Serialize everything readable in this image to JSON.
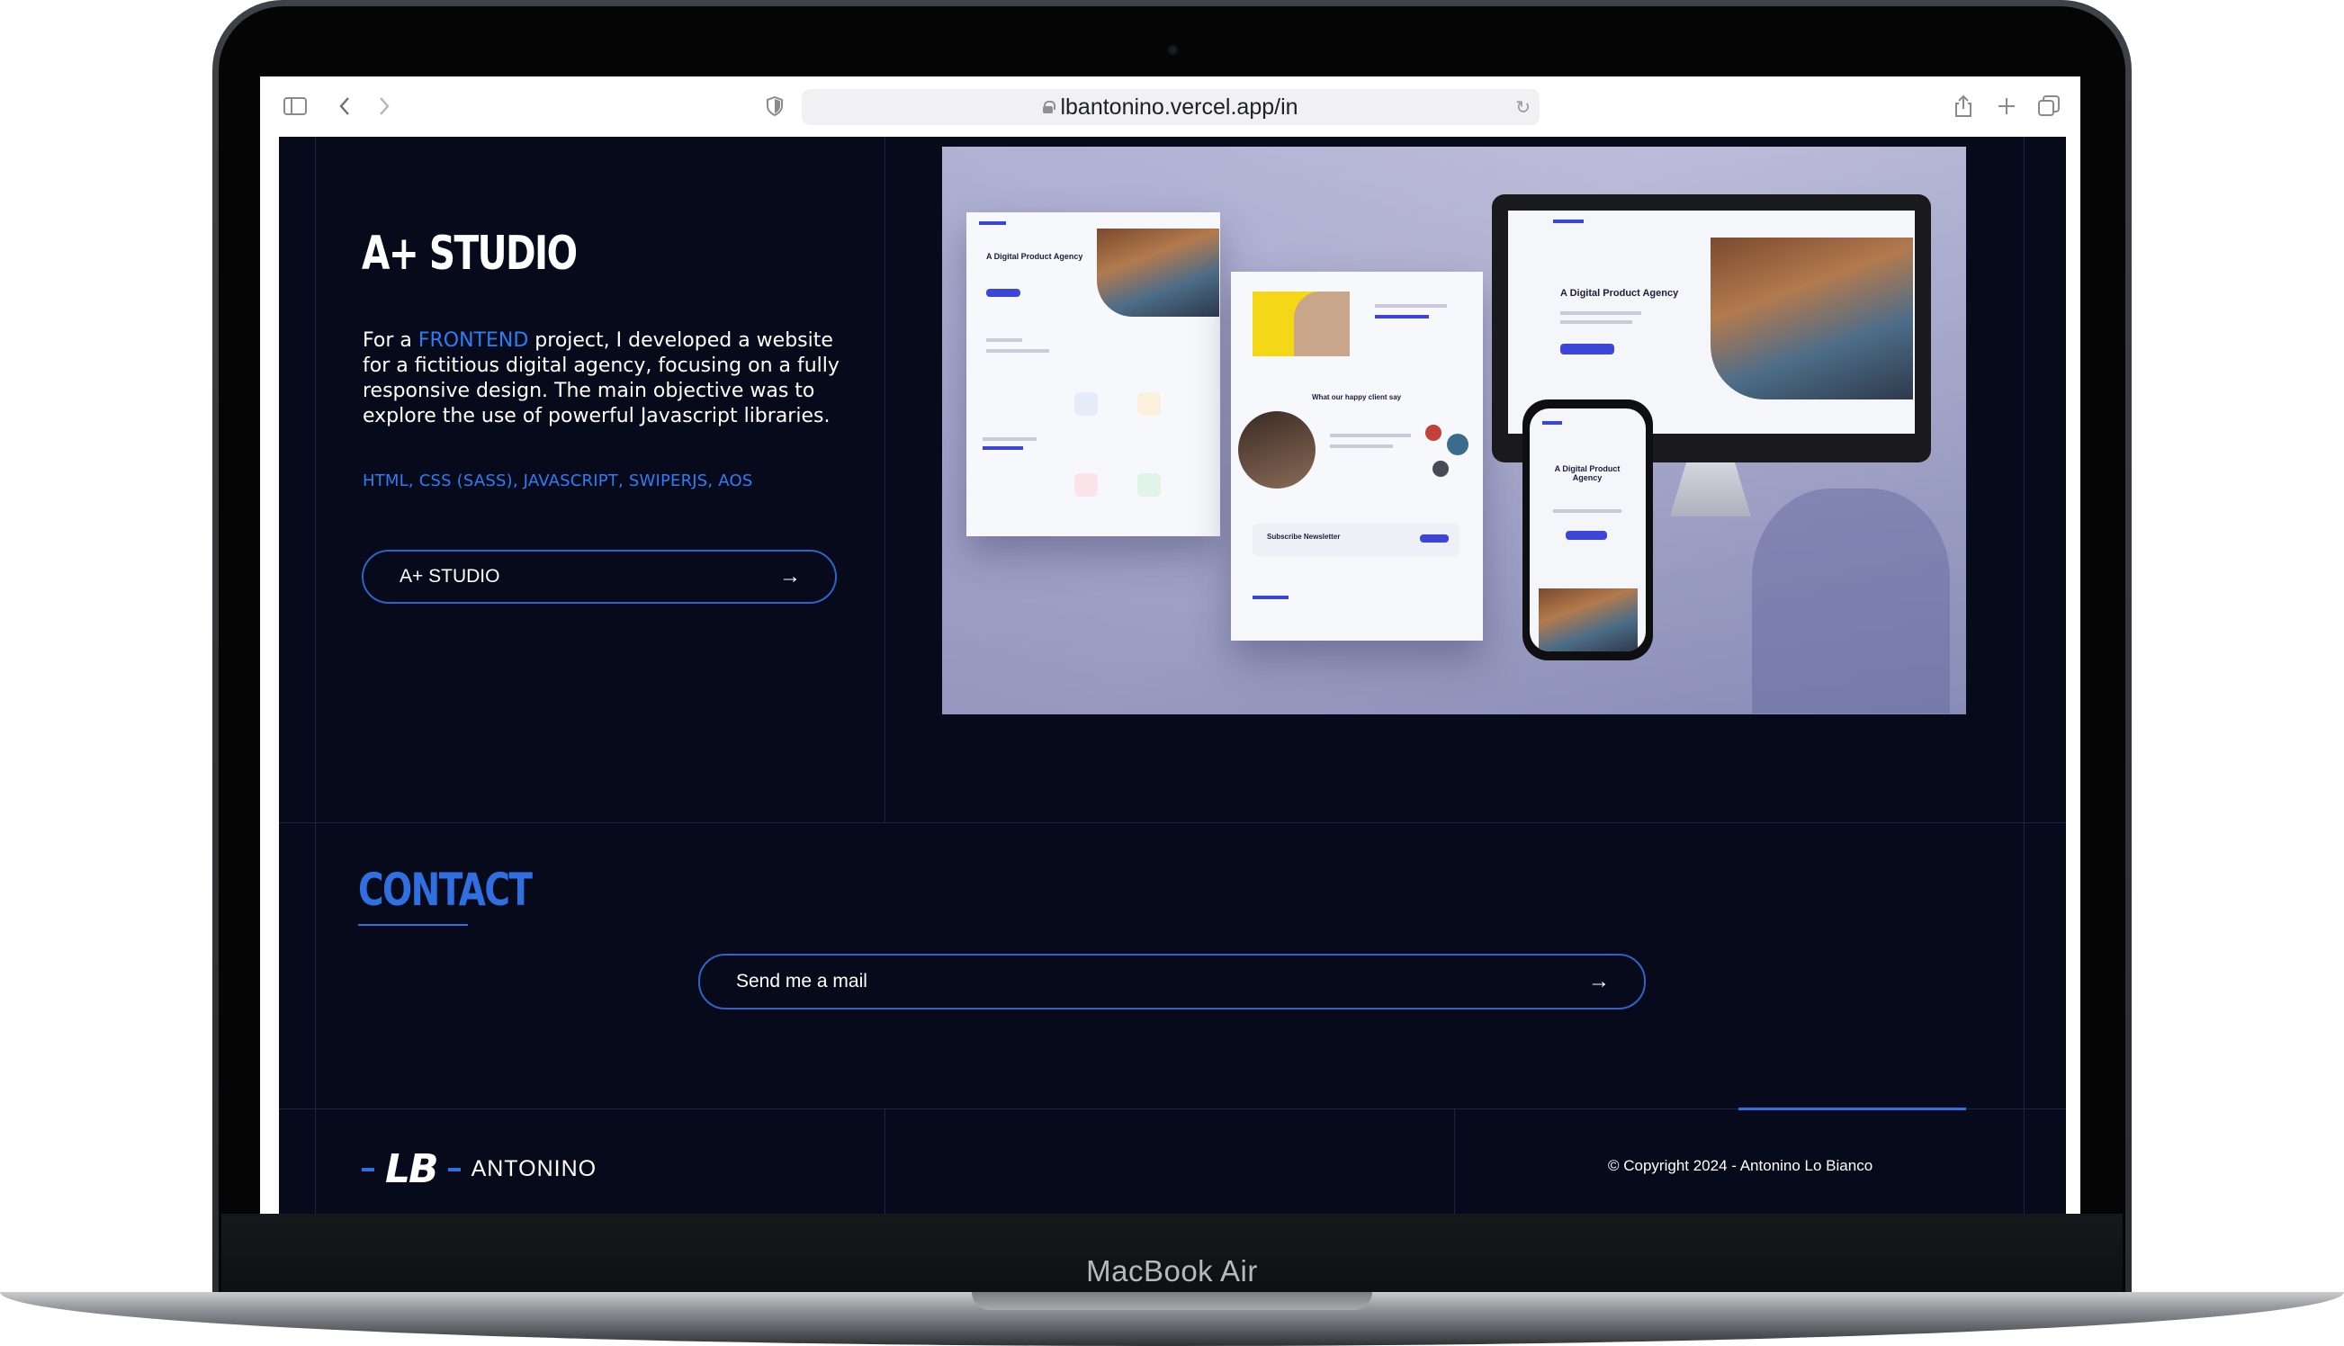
{
  "device": {
    "label": "MacBook Air"
  },
  "browser": {
    "url": "lbantonino.vercel.app/in",
    "icons": [
      "sidebar-icon",
      "back-icon",
      "forward-icon",
      "shield-icon",
      "lock-icon",
      "reload-icon",
      "share-icon",
      "new-tab-icon",
      "tabs-overview-icon"
    ]
  },
  "project": {
    "title": "A+ STUDIO",
    "description_prefix": "For a ",
    "description_highlight": "FRONTEND",
    "description_suffix": " project, I developed a website for a fictitious digital agency, focusing on a fully responsive design. The main objective was to explore the use of powerful Javascript libraries.",
    "tech": "HTML, CSS (SASS), JAVASCRIPT, SWIPERJS, AOS",
    "button_label": "A+ STUDIO",
    "preview": {
      "card_heading": "A Digital Product Agency",
      "phone_heading": "A Digital Product Agency",
      "middle_heading": "What our happy client say",
      "newsletter": "Subscribe Newsletter"
    }
  },
  "contact": {
    "title": "CONTACT",
    "button_label": "Send me a mail"
  },
  "footer": {
    "logo_mark": "LB",
    "logo_name": "ANTONINO",
    "copyright": "© Copyright 2024 - Antonino Lo Bianco"
  },
  "colors": {
    "background": "#060a1b",
    "accent": "#2f6fe0",
    "text": "#ffffff"
  }
}
